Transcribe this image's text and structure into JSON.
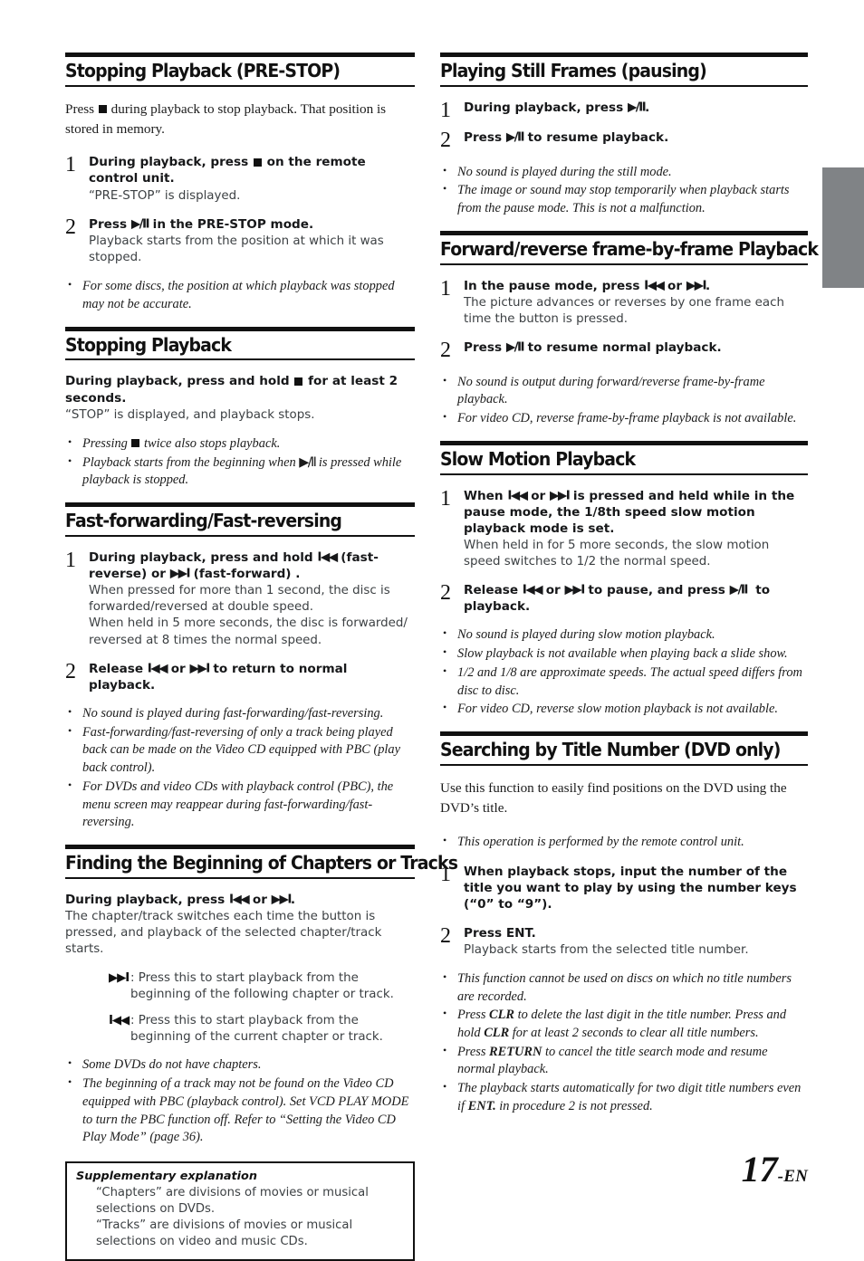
{
  "page": {
    "number": "17",
    "suffix": "-EN"
  },
  "glyphs": {
    "stop": "■",
    "play_pause": "▶/II",
    "prev": "I◀◀",
    "next": "▶▶I"
  },
  "left_column": {
    "sections": [
      {
        "id": "stopping-playback-pre-stop",
        "title": "Stopping Playback (PRE-STOP)",
        "intro": "Press ■ during playback to stop playback. That position is stored in memory.",
        "steps": [
          {
            "num": "1",
            "title": "During playback, press ■ on the remote control unit.",
            "desc": "“PRE-STOP” is displayed."
          },
          {
            "num": "2",
            "title": "Press ▶/II in the PRE-STOP mode.",
            "desc": "Playback starts from the position at which it was stopped."
          }
        ],
        "bullets": [
          "For some discs, the position at which playback was stopped may not be accurate."
        ]
      },
      {
        "id": "stopping-playback",
        "title": "Stopping Playback",
        "lead": "During playback, press and hold ■ for at least 2 seconds.",
        "lead_sub": "“STOP” is displayed, and playback stops.",
        "bullets": [
          "Pressing ■ twice also stops playback.",
          "Playback starts from the beginning when ▶/II is pressed while playback is stopped."
        ]
      },
      {
        "id": "fast-forwarding-fast-reversing",
        "title": "Fast-forwarding/Fast-reversing",
        "steps": [
          {
            "num": "1",
            "title": "During playback, press and hold I◀◀ (fast-reverse) or ▶▶I (fast-forward) .",
            "desc": "When pressed for more than 1 second, the disc is forwarded/reversed at double speed. When held in 5 more seconds, the disc is forwarded/reversed at 8 times the normal speed."
          },
          {
            "num": "2",
            "title": "Release I◀◀ or ▶▶I to return to normal playback.",
            "desc": ""
          }
        ],
        "bullets": [
          "No sound is played during fast-forwarding/fast-reversing.",
          "Fast-forwarding/fast-reversing of only a track being played back can be made on the Video CD equipped with PBC (play back control).",
          "For DVDs and video CDs with playback control (PBC), the menu screen may reappear during fast-forwarding/fast-reversing."
        ]
      },
      {
        "id": "finding-the-beginning-of-chapters-or-tracks",
        "title": "Finding the Beginning of Chapters or Tracks",
        "lead": "During playback, press I◀◀ or ▶▶I.",
        "lead_sub": "The chapter/track switches each time the button is pressed, and playback of the selected chapter/track starts.",
        "key_rows": [
          {
            "key": "▶▶I",
            "text": ": Press this to start playback from the beginning of the following chapter or track."
          },
          {
            "key": "I◀◀",
            "text": ": Press this to start playback from the beginning of the current chapter or track."
          }
        ],
        "bullets": [
          "Some DVDs do not have chapters.",
          "The beginning of a track may not be found on the Video CD equipped with PBC (playback control). Set VCD PLAY MODE to turn the PBC function off. Refer to “Setting the Video CD Play Mode” (page 36)."
        ],
        "supplementary": {
          "title": "Supplementary explanation",
          "paragraphs": [
            "“Chapters” are divisions of movies or musical selections on DVDs.",
            "“Tracks” are divisions of movies or musical selections on video and music CDs."
          ]
        }
      }
    ]
  },
  "right_column": {
    "sections": [
      {
        "id": "playing-still-frames-pausing",
        "title": "Playing Still Frames (pausing)",
        "steps": [
          {
            "num": "1",
            "title": "During playback, press ▶/II.",
            "desc": ""
          },
          {
            "num": "2",
            "title": "Press ▶/II to resume playback.",
            "desc": ""
          }
        ],
        "bullets": [
          "No sound is played during the still mode.",
          "The image or sound may stop temporarily when playback starts from the pause mode. This is not a malfunction."
        ]
      },
      {
        "id": "forward-reverse-frame-by-frame-playback",
        "title": "Forward/reverse frame-by-frame Playback",
        "steps": [
          {
            "num": "1",
            "title": "In the pause mode, press I◀◀ or ▶▶I.",
            "desc": "The picture advances or reverses by one frame each time the button is pressed."
          },
          {
            "num": "2",
            "title": "Press ▶/II to resume normal playback.",
            "desc": ""
          }
        ],
        "bullets": [
          "No sound is output during forward/reverse frame-by-frame playback.",
          "For video CD, reverse frame-by-frame playback is not available."
        ]
      },
      {
        "id": "slow-motion-playback",
        "title": "Slow Motion Playback",
        "steps": [
          {
            "num": "1",
            "title": "When I◀◀ or ▶▶I is pressed and held while in the pause mode, the 1/8th speed slow motion playback mode is set.",
            "desc": "When held in for 5 more seconds, the slow motion speed switches to 1/2 the normal speed."
          },
          {
            "num": "2",
            "title": "Release I◀◀ or ▶▶I to pause, and press ▶/II  to playback.",
            "desc": ""
          }
        ],
        "bullets": [
          "No sound is played during slow motion playback.",
          "Slow playback is not available when playing back a slide show.",
          "1/2 and 1/8 are approximate speeds. The actual speed differs from disc to disc.",
          "For video CD, reverse slow motion playback is not available."
        ]
      },
      {
        "id": "searching-by-title-number-dvd-only",
        "title": "Searching by Title Number (DVD only)",
        "intro": "Use this function to easily find positions on the DVD using the DVD’s title.",
        "pre_bullets": [
          "This operation is performed by the remote control unit."
        ],
        "steps": [
          {
            "num": "1",
            "title": "When playback stops, input the number of the title you want to play by using the number keys (“0” to “9”).",
            "desc": ""
          },
          {
            "num": "2",
            "title": "Press ENT.",
            "desc": "Playback starts from the selected title number."
          }
        ],
        "bullets": [
          "This function cannot be used on discs on which no title numbers are recorded.",
          "Press CLR to delete the last digit in the title number. Press and hold CLR for at least 2 seconds to clear all title numbers.",
          "Press RETURN to cancel the title search mode and resume normal playback.",
          "The playback starts automatically for two digit title numbers even if ENT. in procedure 2 is not pressed."
        ]
      }
    ]
  },
  "colors": {
    "tab_gray": "#808386",
    "rule_black": "#111111",
    "body_gray": "#3c4043"
  }
}
